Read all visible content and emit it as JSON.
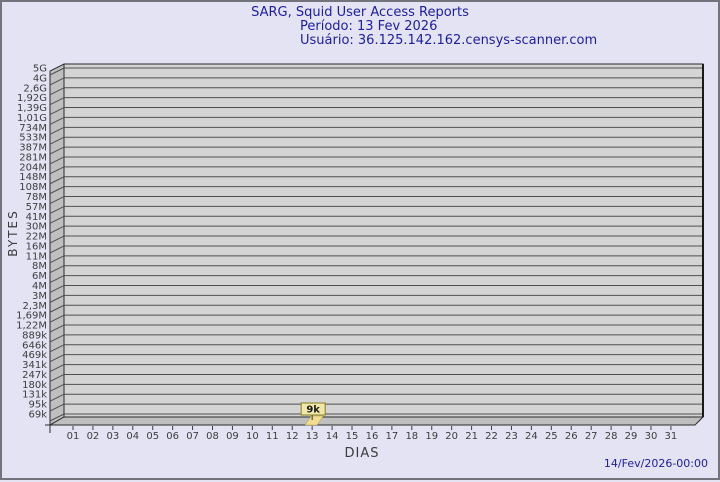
{
  "header": {
    "title": "SARG, Squid User Access Reports",
    "period_label": "Período: 13 Fev 2026",
    "user_label": "Usuário: 36.125.142.162.censys-scanner.com"
  },
  "footer": {
    "timestamp": "14/Fev/2026-00:00"
  },
  "chart_data": {
    "type": "bar",
    "title": "SARG, Squid User Access Reports",
    "xlabel": "DIAS",
    "ylabel": "BYTES",
    "y_scale": "log",
    "grid": true,
    "categories": [
      "01",
      "02",
      "03",
      "04",
      "05",
      "06",
      "07",
      "08",
      "09",
      "10",
      "11",
      "12",
      "13",
      "14",
      "15",
      "16",
      "17",
      "18",
      "19",
      "20",
      "21",
      "22",
      "23",
      "24",
      "25",
      "26",
      "27",
      "28",
      "29",
      "30",
      "31"
    ],
    "values": [
      0,
      0,
      0,
      0,
      0,
      0,
      0,
      0,
      0,
      0,
      0,
      0,
      9000,
      0,
      0,
      0,
      0,
      0,
      0,
      0,
      0,
      0,
      0,
      0,
      0,
      0,
      0,
      0,
      0,
      0,
      0
    ],
    "annotations": [
      {
        "category": "13",
        "label": "9k",
        "value_bytes": 9000
      }
    ],
    "y_ticks": [
      "5G",
      "4G",
      "2,6G",
      "1,92G",
      "1,39G",
      "1,01G",
      "734M",
      "533M",
      "387M",
      "281M",
      "204M",
      "148M",
      "108M",
      "78M",
      "57M",
      "41M",
      "30M",
      "22M",
      "16M",
      "11M",
      "8M",
      "6M",
      "4M",
      "3M",
      "2,3M",
      "1,69M",
      "1,22M",
      "889k",
      "646k",
      "469k",
      "341k",
      "247k",
      "180k",
      "131k",
      "95k",
      "69k"
    ],
    "colors": {
      "page_bg": "#e3e3f4",
      "title_text": "#20209c",
      "plot_bg": "#d4d4d4",
      "wall": "#bfbfbf",
      "grid": "#4f4f4f",
      "axis_text": "#3d3d3d",
      "bar": "#f2dc8f",
      "bar_edge": "#b3a040",
      "label_box_bg": "#efe8aa",
      "label_box_border": "#8a7d1e",
      "label_text": "#1a1a1a"
    }
  }
}
